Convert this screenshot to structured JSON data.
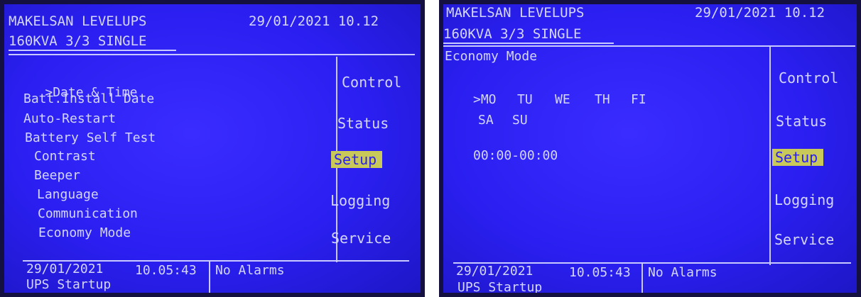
{
  "panels": [
    {
      "header": {
        "brand": "MAKELSAN LEVELUPS",
        "datetime": "29/01/2021 10.12",
        "model": "160KVA 3/3 SINGLE"
      },
      "setup_menu": {
        "selected_marker": ">",
        "items": [
          "Date & Time",
          "Batt.Install Date",
          "Auto-Restart",
          "Battery Self Test",
          "Contrast",
          "Beeper",
          "Language",
          "Communication",
          "Economy Mode"
        ]
      },
      "side_menu": [
        "Control",
        "Status",
        "Setup",
        "Logging",
        "Service"
      ],
      "active_menu": "Setup",
      "footer": {
        "date": "29/01/2021",
        "time": "10.05:43",
        "status": "UPS Startup",
        "alarms": "No Alarms"
      }
    },
    {
      "header": {
        "brand": "MAKELSAN LEVELUPS",
        "datetime": "29/01/2021 10.12",
        "model": "160KVA 3/3 SINGLE"
      },
      "screen_title": "Economy Mode",
      "days_row1": [
        ">MO",
        "TU",
        "WE",
        "TH",
        "FI"
      ],
      "days_row2": [
        "SA",
        "SU"
      ],
      "time_range": "00:00-00:00",
      "side_menu": [
        "Control",
        "Status",
        "Setup",
        "Logging",
        "Service"
      ],
      "active_menu": "Setup",
      "footer": {
        "date": "29/01/2021",
        "time": "10.05:43",
        "status": "UPS Startup",
        "alarms": "No Alarms"
      }
    }
  ],
  "colors": {
    "screen_bg": "#2a1ff0",
    "text": "#d4d6ff",
    "highlight": "#c9c95a"
  }
}
